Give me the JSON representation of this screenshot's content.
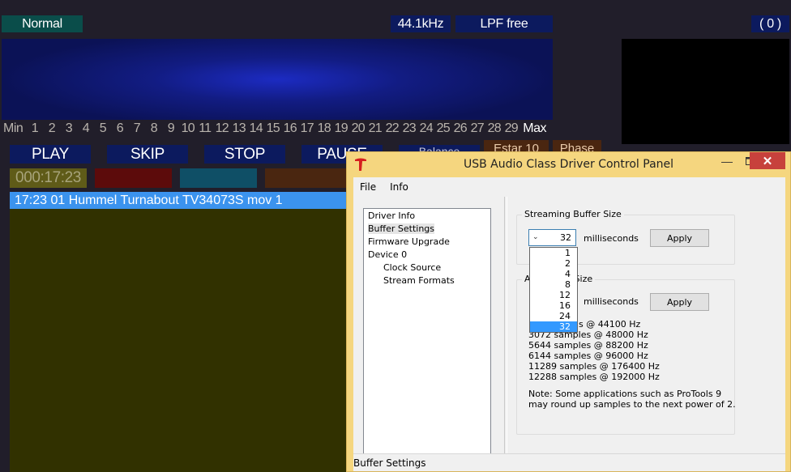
{
  "player": {
    "mode": "Normal",
    "sample_rate": "44.1kHz",
    "filter": "LPF free",
    "count": "( 0 )",
    "scale_min": "Min",
    "scale_max": "Max",
    "scale_numbers": [
      "1",
      "2",
      "3",
      "4",
      "5",
      "6",
      "7",
      "8",
      "9",
      "10",
      "11",
      "12",
      "13",
      "14",
      "15",
      "16",
      "17",
      "18",
      "19",
      "20",
      "21",
      "22",
      "23",
      "24",
      "25",
      "26",
      "27",
      "28",
      "29"
    ],
    "buttons": {
      "play": "PLAY",
      "skip": "SKIP",
      "stop": "STOP",
      "pause": "PAUSE",
      "balance": "Balance",
      "estar": "Estar 10",
      "phase": "Phase"
    },
    "time": "000:17:23",
    "playlist": [
      "17:23  01 Hummel Turnabout TV34073S mov 1"
    ]
  },
  "dialog": {
    "title": "USB Audio Class Driver Control Panel",
    "menu": [
      "File",
      "Info"
    ],
    "tree": {
      "items": [
        {
          "label": "Driver Info",
          "child": false
        },
        {
          "label": "Buffer Settings",
          "child": false,
          "selected": true
        },
        {
          "label": "Firmware Upgrade",
          "child": false
        },
        {
          "label": "Device 0",
          "child": false
        },
        {
          "label": "Clock Source",
          "child": true
        },
        {
          "label": "Stream Formats",
          "child": true
        }
      ]
    },
    "streaming": {
      "title": "Streaming Buffer Size",
      "value": "32",
      "unit": "milliseconds",
      "apply": "Apply"
    },
    "asio": {
      "title_visible": "A",
      "title_visible_tail": "Size",
      "unit": "milliseconds",
      "apply": "Apply",
      "samples": [
        "s @ 44100 Hz",
        "3072 samples @ 48000 Hz",
        "5644 samples @ 88200 Hz",
        "6144 samples @ 96000 Hz",
        "11289 samples @ 176400 Hz",
        "12288 samples @ 192000 Hz"
      ],
      "note_line1": "Note: Some applications such as ProTools 9",
      "note_line2": "may round up samples to the next power of 2."
    },
    "dropdown_options": [
      "1",
      "2",
      "4",
      "8",
      "12",
      "16",
      "24",
      "32"
    ],
    "dropdown_selected": "32",
    "status": "Buffer Settings"
  },
  "colors": {
    "accent": "#3399ff",
    "dialog_frame": "#f5d67f",
    "close": "#c7413c"
  }
}
